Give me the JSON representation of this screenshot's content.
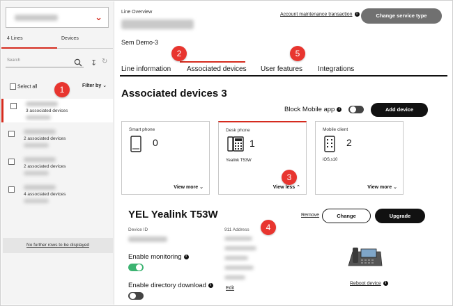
{
  "sidebar": {
    "tabs": [
      {
        "label": "4 Lines"
      },
      {
        "label": "Devices"
      }
    ],
    "search_placeholder": "Search",
    "select_all_label": "Select all",
    "filter_label": "Filter by",
    "lines": [
      {
        "devices": "3 associated devices"
      },
      {
        "devices": "2 associated devices"
      },
      {
        "devices": "2 associated devices"
      },
      {
        "devices": "4 associated devices"
      }
    ],
    "footer_text": "No further rows to be displayed"
  },
  "header": {
    "overview_label": "Line Overview",
    "line_name": "Sem Demo-3",
    "account_maintenance_link": "Account maintenance transaction",
    "change_service_button": "Change service type"
  },
  "tabs": [
    {
      "label": "Line information"
    },
    {
      "label": "Associated devices"
    },
    {
      "label": "User features"
    },
    {
      "label": "Integrations"
    }
  ],
  "associated": {
    "title": "Associated devices 3",
    "block_mobile_label": "Block Mobile app",
    "block_mobile_enabled": false,
    "add_device_button": "Add device"
  },
  "cards": [
    {
      "title": "Smart phone",
      "count": "0",
      "sub": "",
      "toggle": "View more",
      "icon": "tablet-icon"
    },
    {
      "title": "Desk phone",
      "count": "1",
      "sub": "Yealink T53W",
      "toggle": "View less",
      "icon": "desk-phone-icon"
    },
    {
      "title": "Mobile client",
      "count": "2",
      "sub": "iOS,s10",
      "toggle": "View more",
      "icon": "mobile-client-icon"
    }
  ],
  "device": {
    "title": "YEL Yealink T53W",
    "remove_link": "Remove",
    "change_button": "Change",
    "upgrade_button": "Upgrade",
    "device_id_label": "Device ID",
    "address_label": "911 Address",
    "enable_monitoring_label": "Enable monitoring",
    "enable_monitoring_on": true,
    "enable_directory_label": "Enable directory download",
    "enable_directory_on": false,
    "edit_link": "Edit",
    "reboot_link": "Reboot device"
  },
  "annotations": [
    "1",
    "2",
    "3",
    "4",
    "5"
  ],
  "colors": {
    "accent": "#d52b1e",
    "badge": "#e8352f",
    "toggle_on": "#3cb371"
  }
}
